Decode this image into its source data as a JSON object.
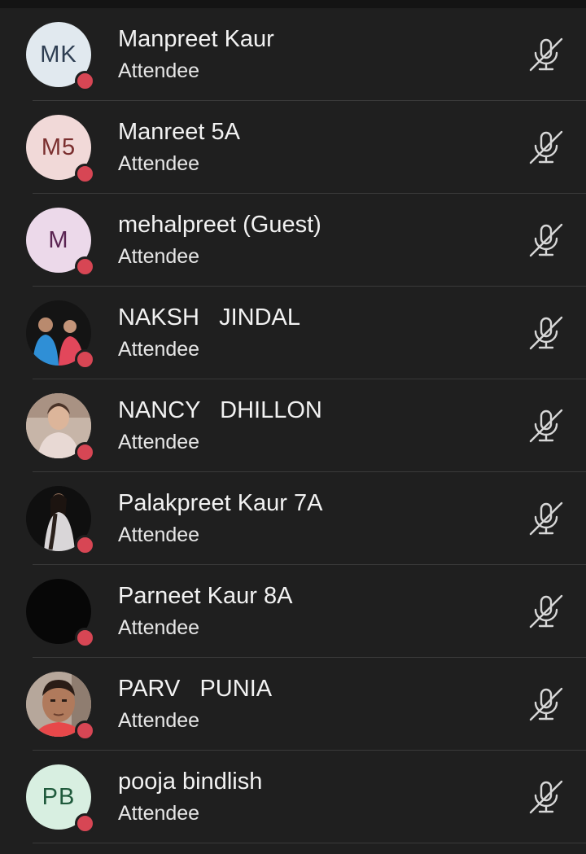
{
  "participants": [
    {
      "name": "Manpreet Kaur",
      "role": "Attendee",
      "initials": "MK",
      "avatar_bg": "#e1e9ef",
      "avatar_fg": "#2e3e52",
      "status": "busy"
    },
    {
      "name": "Manreet 5A",
      "role": "Attendee",
      "initials": "M5",
      "avatar_bg": "#f1d9d8",
      "avatar_fg": "#7a2e2e",
      "status": "busy"
    },
    {
      "name": "mehalpreet (Guest)",
      "role": "Attendee",
      "initials": "M",
      "avatar_bg": "#ecd9ea",
      "avatar_fg": "#5a2452",
      "status": "busy"
    },
    {
      "name": "NAKSH   JINDAL",
      "role": "Attendee",
      "initials": "",
      "avatar_bg": "#1a1a1a",
      "avatar_fg": "#ffffff",
      "status": "busy",
      "photo": "two-children-photo"
    },
    {
      "name": "NANCY   DHILLON",
      "role": "Attendee",
      "initials": "",
      "avatar_bg": "#bda99d",
      "avatar_fg": "#ffffff",
      "status": "busy",
      "photo": "girl-portrait-photo"
    },
    {
      "name": "Palakpreet Kaur 7A",
      "role": "Attendee",
      "initials": "",
      "avatar_bg": "#151515",
      "avatar_fg": "#ffffff",
      "status": "busy",
      "photo": "girl-portrait-dark-photo"
    },
    {
      "name": "Parneet Kaur 8A",
      "role": "Attendee",
      "initials": "",
      "avatar_bg": "#070707",
      "avatar_fg": "#ffffff",
      "status": "busy",
      "photo": "black-photo"
    },
    {
      "name": "PARV   PUNIA",
      "role": "Attendee",
      "initials": "",
      "avatar_bg": "#9c8a7e",
      "avatar_fg": "#ffffff",
      "status": "busy",
      "photo": "boy-portrait-photo"
    },
    {
      "name": "pooja bindlish",
      "role": "Attendee",
      "initials": "PB",
      "avatar_bg": "#d8efe1",
      "avatar_fg": "#1f5a3c",
      "status": "busy"
    }
  ],
  "icons": {
    "mic": "mic-muted-icon",
    "status": "busy-status-dot"
  },
  "colors": {
    "background": "#1f1f1f",
    "divider": "#3a3a3a",
    "status_busy": "#d74654",
    "text": "#f2f2f2"
  }
}
